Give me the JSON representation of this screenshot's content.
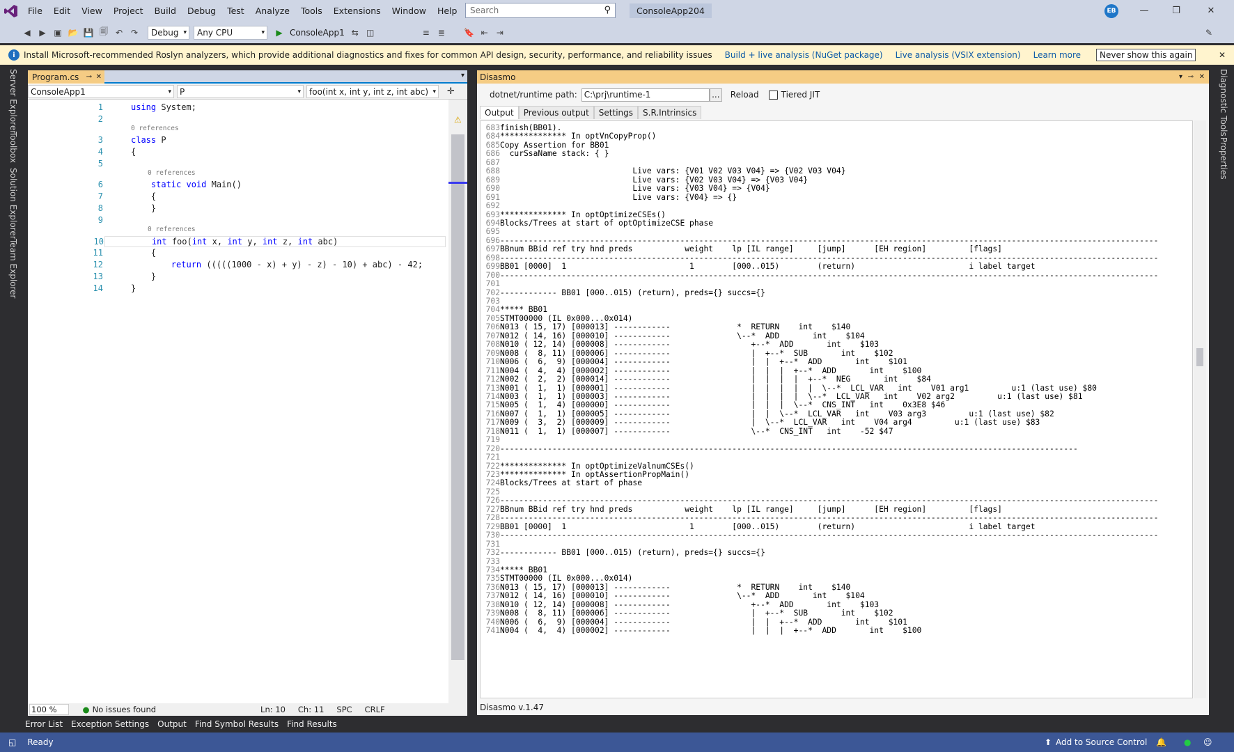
{
  "menu": [
    "File",
    "Edit",
    "View",
    "Project",
    "Build",
    "Debug",
    "Test",
    "Analyze",
    "Tools",
    "Extensions",
    "Window",
    "Help"
  ],
  "search": {
    "placeholder": "Search"
  },
  "app_title": "ConsoleApp204",
  "user_initials": "EB",
  "toolbar": {
    "config": "Debug",
    "platform": "Any CPU",
    "start_project": "ConsoleApp1"
  },
  "infobar": {
    "message": "Install Microsoft-recommended Roslyn analyzers, which provide additional diagnostics and fixes for common API design, security, performance, and reliability issues",
    "link1": "Build + live analysis (NuGet package)",
    "link2": "Live analysis (VSIX extension)",
    "link3": "Learn more",
    "button": "Never show this again"
  },
  "left_tabs": [
    "Server Explorer",
    "Toolbox",
    "Solution Explorer",
    "Team Explorer"
  ],
  "right_tabs": [
    "Diagnostic Tools",
    "Properties"
  ],
  "editor": {
    "tab": "Program.cs",
    "nav": {
      "project": "ConsoleApp1",
      "type": "P",
      "member": "foo(int x, int y, int z, int abc)"
    },
    "refs": "0 references",
    "lines": [
      {
        "n": "1",
        "t": "using System;"
      },
      {
        "n": "2",
        "t": ""
      },
      {
        "n": "3",
        "t": "class P"
      },
      {
        "n": "4",
        "t": "{"
      },
      {
        "n": "5",
        "t": ""
      },
      {
        "n": "6",
        "t": "    static void Main()"
      },
      {
        "n": "7",
        "t": "    {"
      },
      {
        "n": "8",
        "t": "    }"
      },
      {
        "n": "9",
        "t": ""
      },
      {
        "n": "10",
        "t": "    int foo(int x, int y, int z, int abc)"
      },
      {
        "n": "11",
        "t": "    {"
      },
      {
        "n": "12",
        "t": "        return (((((1000 - x) + y) - z) - 10) + abc) - 42;"
      },
      {
        "n": "13",
        "t": "    }"
      },
      {
        "n": "14",
        "t": "}"
      }
    ],
    "zoom": "100 %",
    "issues": "No issues found",
    "ln": "Ln: 10",
    "ch": "Ch: 11",
    "spc": "SPC",
    "crlf": "CRLF"
  },
  "disasmo": {
    "title": "Disasmo",
    "path_label": "dotnet/runtime path:",
    "path_value": "C:\\prj\\runtime-1",
    "browse": "...",
    "reload": "Reload",
    "tiered": "Tiered JIT",
    "tabs": [
      "Output",
      "Previous output",
      "Settings",
      "S.R.Intrinsics"
    ],
    "version": "Disasmo v.1.47",
    "lines": [
      [
        "683",
        "finish(BB01)."
      ],
      [
        "684",
        "************** In optVnCopyProp()"
      ],
      [
        "685",
        "Copy Assertion for BB01"
      ],
      [
        "686",
        "  curSsaName stack: { }"
      ],
      [
        "687",
        ""
      ],
      [
        "688",
        "                            Live vars: {V01 V02 V03 V04} => {V02 V03 V04}"
      ],
      [
        "689",
        "                            Live vars: {V02 V03 V04} => {V03 V04}"
      ],
      [
        "690",
        "                            Live vars: {V03 V04} => {V04}"
      ],
      [
        "691",
        "                            Live vars: {V04} => {}"
      ],
      [
        "692",
        ""
      ],
      [
        "693",
        "************** In optOptimizeCSEs()"
      ],
      [
        "694",
        "Blocks/Trees at start of optOptimizeCSE phase"
      ],
      [
        "695",
        ""
      ],
      [
        "696",
        "-------------------------------------------------------------------------------------------------------------------------------------------"
      ],
      [
        "697",
        "BBnum BBid ref try hnd preds           weight    lp [IL range]     [jump]      [EH region]         [flags]"
      ],
      [
        "698",
        "-------------------------------------------------------------------------------------------------------------------------------------------"
      ],
      [
        "699",
        "BB01 [0000]  1                          1        [000..015)        (return)                        i label target"
      ],
      [
        "700",
        "-------------------------------------------------------------------------------------------------------------------------------------------"
      ],
      [
        "701",
        ""
      ],
      [
        "702",
        "------------ BB01 [000..015) (return), preds={} succs={}"
      ],
      [
        "703",
        ""
      ],
      [
        "704",
        "***** BB01"
      ],
      [
        "705",
        "STMT00000 (IL 0x000...0x014)"
      ],
      [
        "706",
        "N013 ( 15, 17) [000013] ------------              *  RETURN    int    $140"
      ],
      [
        "707",
        "N012 ( 14, 16) [000010] ------------              \\--*  ADD       int    $104"
      ],
      [
        "708",
        "N010 ( 12, 14) [000008] ------------                 +--*  ADD       int    $103"
      ],
      [
        "709",
        "N008 (  8, 11) [000006] ------------                 |  +--*  SUB       int    $102"
      ],
      [
        "710",
        "N006 (  6,  9) [000004] ------------                 |  |  +--*  ADD       int    $101"
      ],
      [
        "711",
        "N004 (  4,  4) [000002] ------------                 |  |  |  +--*  ADD       int    $100"
      ],
      [
        "712",
        "N002 (  2,  2) [000014] ------------                 |  |  |  |  +--*  NEG       int    $84"
      ],
      [
        "713",
        "N001 (  1,  1) [000001] ------------                 |  |  |  |  |  \\--*  LCL_VAR   int    V01 arg1         u:1 (last use) $80"
      ],
      [
        "714",
        "N003 (  1,  1) [000003] ------------                 |  |  |  |  \\--*  LCL_VAR   int    V02 arg2         u:1 (last use) $81"
      ],
      [
        "715",
        "N005 (  1,  4) [000000] ------------                 |  |  |  \\--*  CNS_INT   int    0x3E8 $46"
      ],
      [
        "716",
        "N007 (  1,  1) [000005] ------------                 |  |  \\--*  LCL_VAR   int    V03 arg3         u:1 (last use) $82"
      ],
      [
        "717",
        "N009 (  3,  2) [000009] ------------                 |  \\--*  LCL_VAR   int    V04 arg4         u:1 (last use) $83"
      ],
      [
        "718",
        "N011 (  1,  1) [000007] ------------                 \\--*  CNS_INT   int    -52 $47"
      ],
      [
        "719",
        ""
      ],
      [
        "720",
        "--------------------------------------------------------------------------------------------------------------------------"
      ],
      [
        "721",
        ""
      ],
      [
        "722",
        "************** In optOptimizeValnumCSEs()"
      ],
      [
        "723",
        "************** In optAssertionPropMain()"
      ],
      [
        "724",
        "Blocks/Trees at start of phase"
      ],
      [
        "725",
        ""
      ],
      [
        "726",
        "-------------------------------------------------------------------------------------------------------------------------------------------"
      ],
      [
        "727",
        "BBnum BBid ref try hnd preds           weight    lp [IL range]     [jump]      [EH region]         [flags]"
      ],
      [
        "728",
        "-------------------------------------------------------------------------------------------------------------------------------------------"
      ],
      [
        "729",
        "BB01 [0000]  1                          1        [000..015)        (return)                        i label target"
      ],
      [
        "730",
        "-------------------------------------------------------------------------------------------------------------------------------------------"
      ],
      [
        "731",
        ""
      ],
      [
        "732",
        "------------ BB01 [000..015) (return), preds={} succs={}"
      ],
      [
        "733",
        ""
      ],
      [
        "734",
        "***** BB01"
      ],
      [
        "735",
        "STMT00000 (IL 0x000...0x014)"
      ],
      [
        "736",
        "N013 ( 15, 17) [000013] ------------              *  RETURN    int    $140"
      ],
      [
        "737",
        "N012 ( 14, 16) [000010] ------------              \\--*  ADD       int    $104"
      ],
      [
        "738",
        "N010 ( 12, 14) [000008] ------------                 +--*  ADD       int    $103"
      ],
      [
        "739",
        "N008 (  8, 11) [000006] ------------                 |  +--*  SUB       int    $102"
      ],
      [
        "740",
        "N006 (  6,  9) [000004] ------------                 |  |  +--*  ADD       int    $101"
      ],
      [
        "741",
        "N004 (  4,  4) [000002] ------------                 |  |  |  +--*  ADD       int    $100"
      ]
    ]
  },
  "bottom_tabs": [
    "Error List",
    "Exception Settings",
    "Output",
    "Find Symbol Results",
    "Find Results"
  ],
  "status": {
    "ready": "Ready",
    "source_control": "Add to Source Control"
  }
}
